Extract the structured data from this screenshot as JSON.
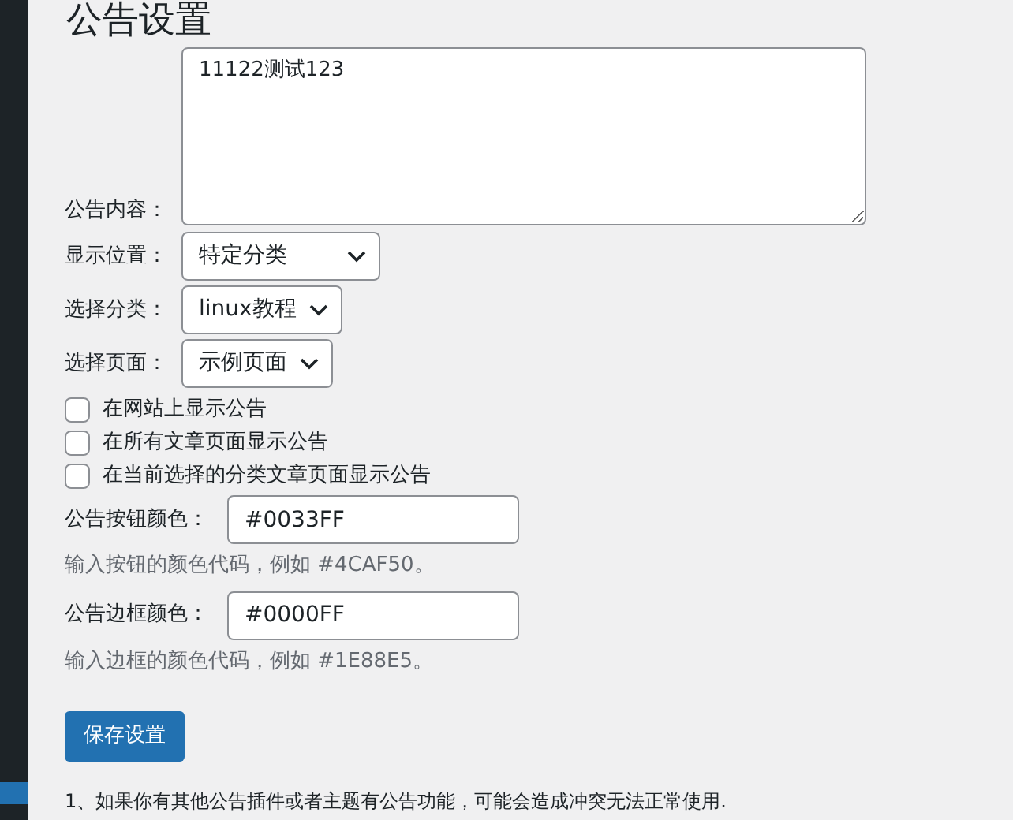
{
  "title": "公告设置",
  "content": {
    "label": "公告内容：",
    "value": "11122测试123"
  },
  "selects": [
    {
      "label": "显示位置：",
      "value": "特定分类",
      "wide": true
    },
    {
      "label": "选择分类：",
      "value": "linux教程",
      "wide": false
    },
    {
      "label": "选择页面：",
      "value": "示例页面",
      "wide": false
    }
  ],
  "checkboxes": [
    {
      "label": "在网站上显示公告",
      "checked": false
    },
    {
      "label": "在所有文章页面显示公告",
      "checked": false
    },
    {
      "label": "在当前选择的分类文章页面显示公告",
      "checked": false
    }
  ],
  "colors": [
    {
      "label": "公告按钮颜色：",
      "value": "#0033FF",
      "hint": "输入按钮的颜色代码，例如 #4CAF50。"
    },
    {
      "label": "公告边框颜色：",
      "value": "#0000FF",
      "hint": "输入边框的颜色代码，例如 #1E88E5。"
    }
  ],
  "save_button": "保存设置",
  "note": "1、如果你有其他公告插件或者主题有公告功能，可能会造成冲突无法正常使用."
}
